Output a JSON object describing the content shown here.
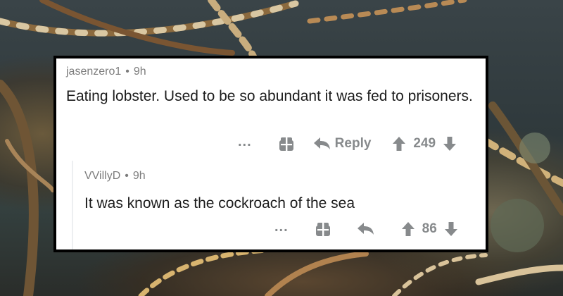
{
  "comments": [
    {
      "username": "jasenzero1",
      "age": "9h",
      "text": "Eating lobster.  Used to be so abundant it was fed to prisoners.",
      "more_label": "...",
      "reply_label": "Reply",
      "score": "249"
    },
    {
      "username": "VVillyD",
      "age": "9h",
      "text": "It was known as the cockroach of the sea",
      "more_label": "...",
      "score": "86"
    }
  ],
  "separator": "•",
  "icons": {
    "more": "ellipsis-icon",
    "award": "gift-award-icon",
    "reply": "reply-arrow-icon",
    "upvote": "up-arrow-icon",
    "downvote": "down-arrow-icon"
  },
  "colors": {
    "card_border": "#000000",
    "card_bg": "#ffffff",
    "meta_text": "#7c7c7c",
    "body_text": "#1c1c1c",
    "action_text": "#878a8c"
  }
}
